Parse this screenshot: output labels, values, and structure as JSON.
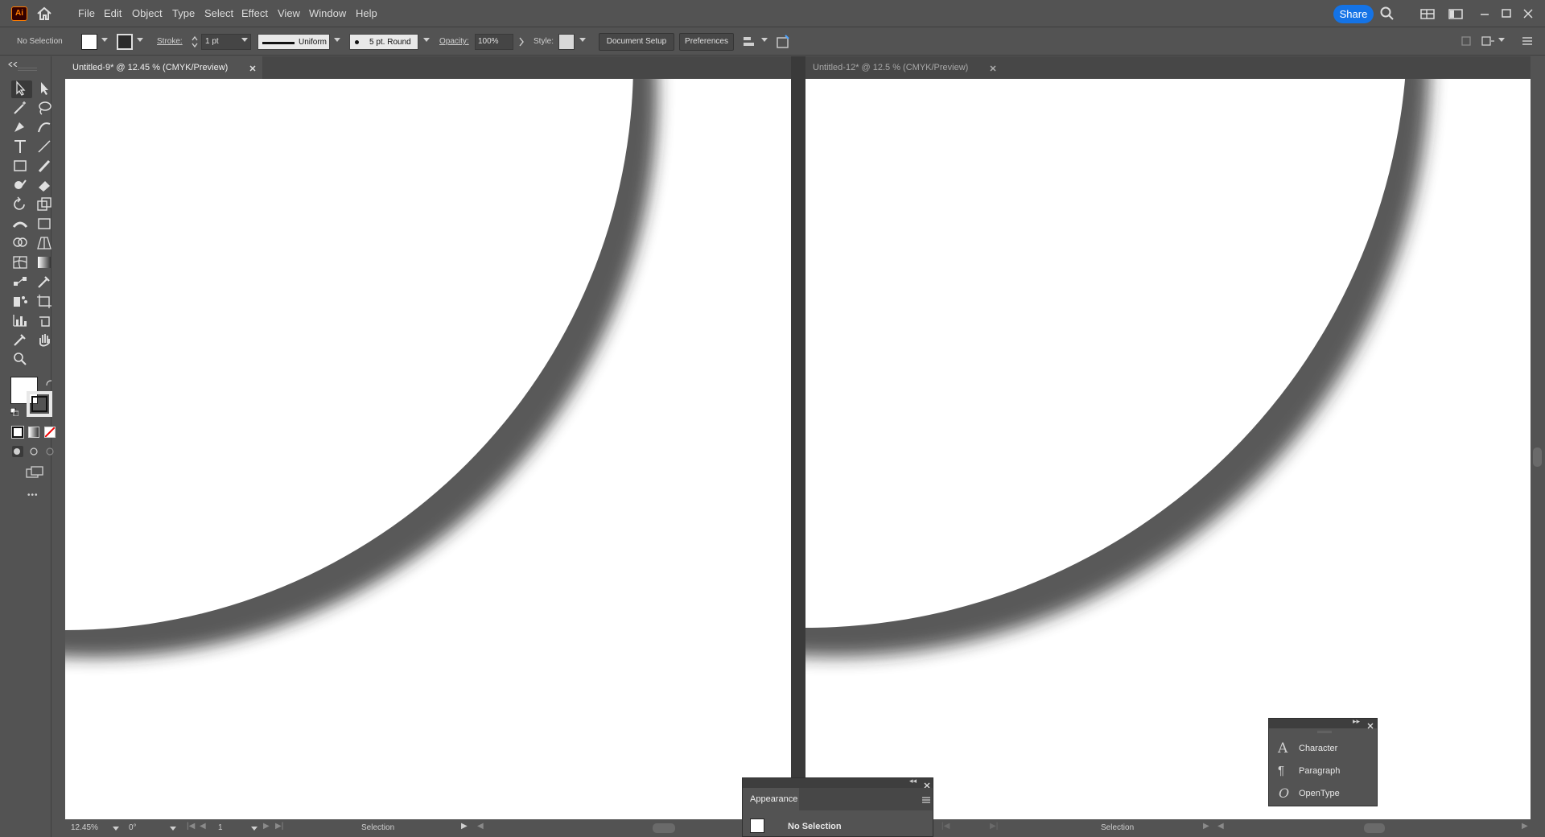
{
  "app": {
    "logo_text": "Ai",
    "accent": "#ff7c00"
  },
  "menu": [
    "File",
    "Edit",
    "Object",
    "Type",
    "Select",
    "Effect",
    "View",
    "Window",
    "Help"
  ],
  "share_label": "Share",
  "control": {
    "selection": "No Selection",
    "stroke_label": "Stroke:",
    "stroke_value": "1 pt",
    "profile": "Uniform",
    "brush": "5 pt. Round",
    "opacity_label": "Opacity:",
    "opacity_value": "100%",
    "style_label": "Style:",
    "doc_setup": "Document Setup",
    "preferences": "Preferences"
  },
  "docs": [
    {
      "tab": "Untitled-9* @ 12.45 % (CMYK/Preview)",
      "zoom": "12.45%",
      "rotation": "0°",
      "artboard": "1",
      "status": "Selection"
    },
    {
      "tab": "Untitled-12* @ 12.5 % (CMYK/Preview)",
      "status": "Selection"
    }
  ],
  "appearance_panel": {
    "title": "Appearance",
    "row": "No Selection"
  },
  "type_panel": {
    "items": [
      "Character",
      "Paragraph",
      "OpenType"
    ]
  },
  "more_tools": "•••"
}
